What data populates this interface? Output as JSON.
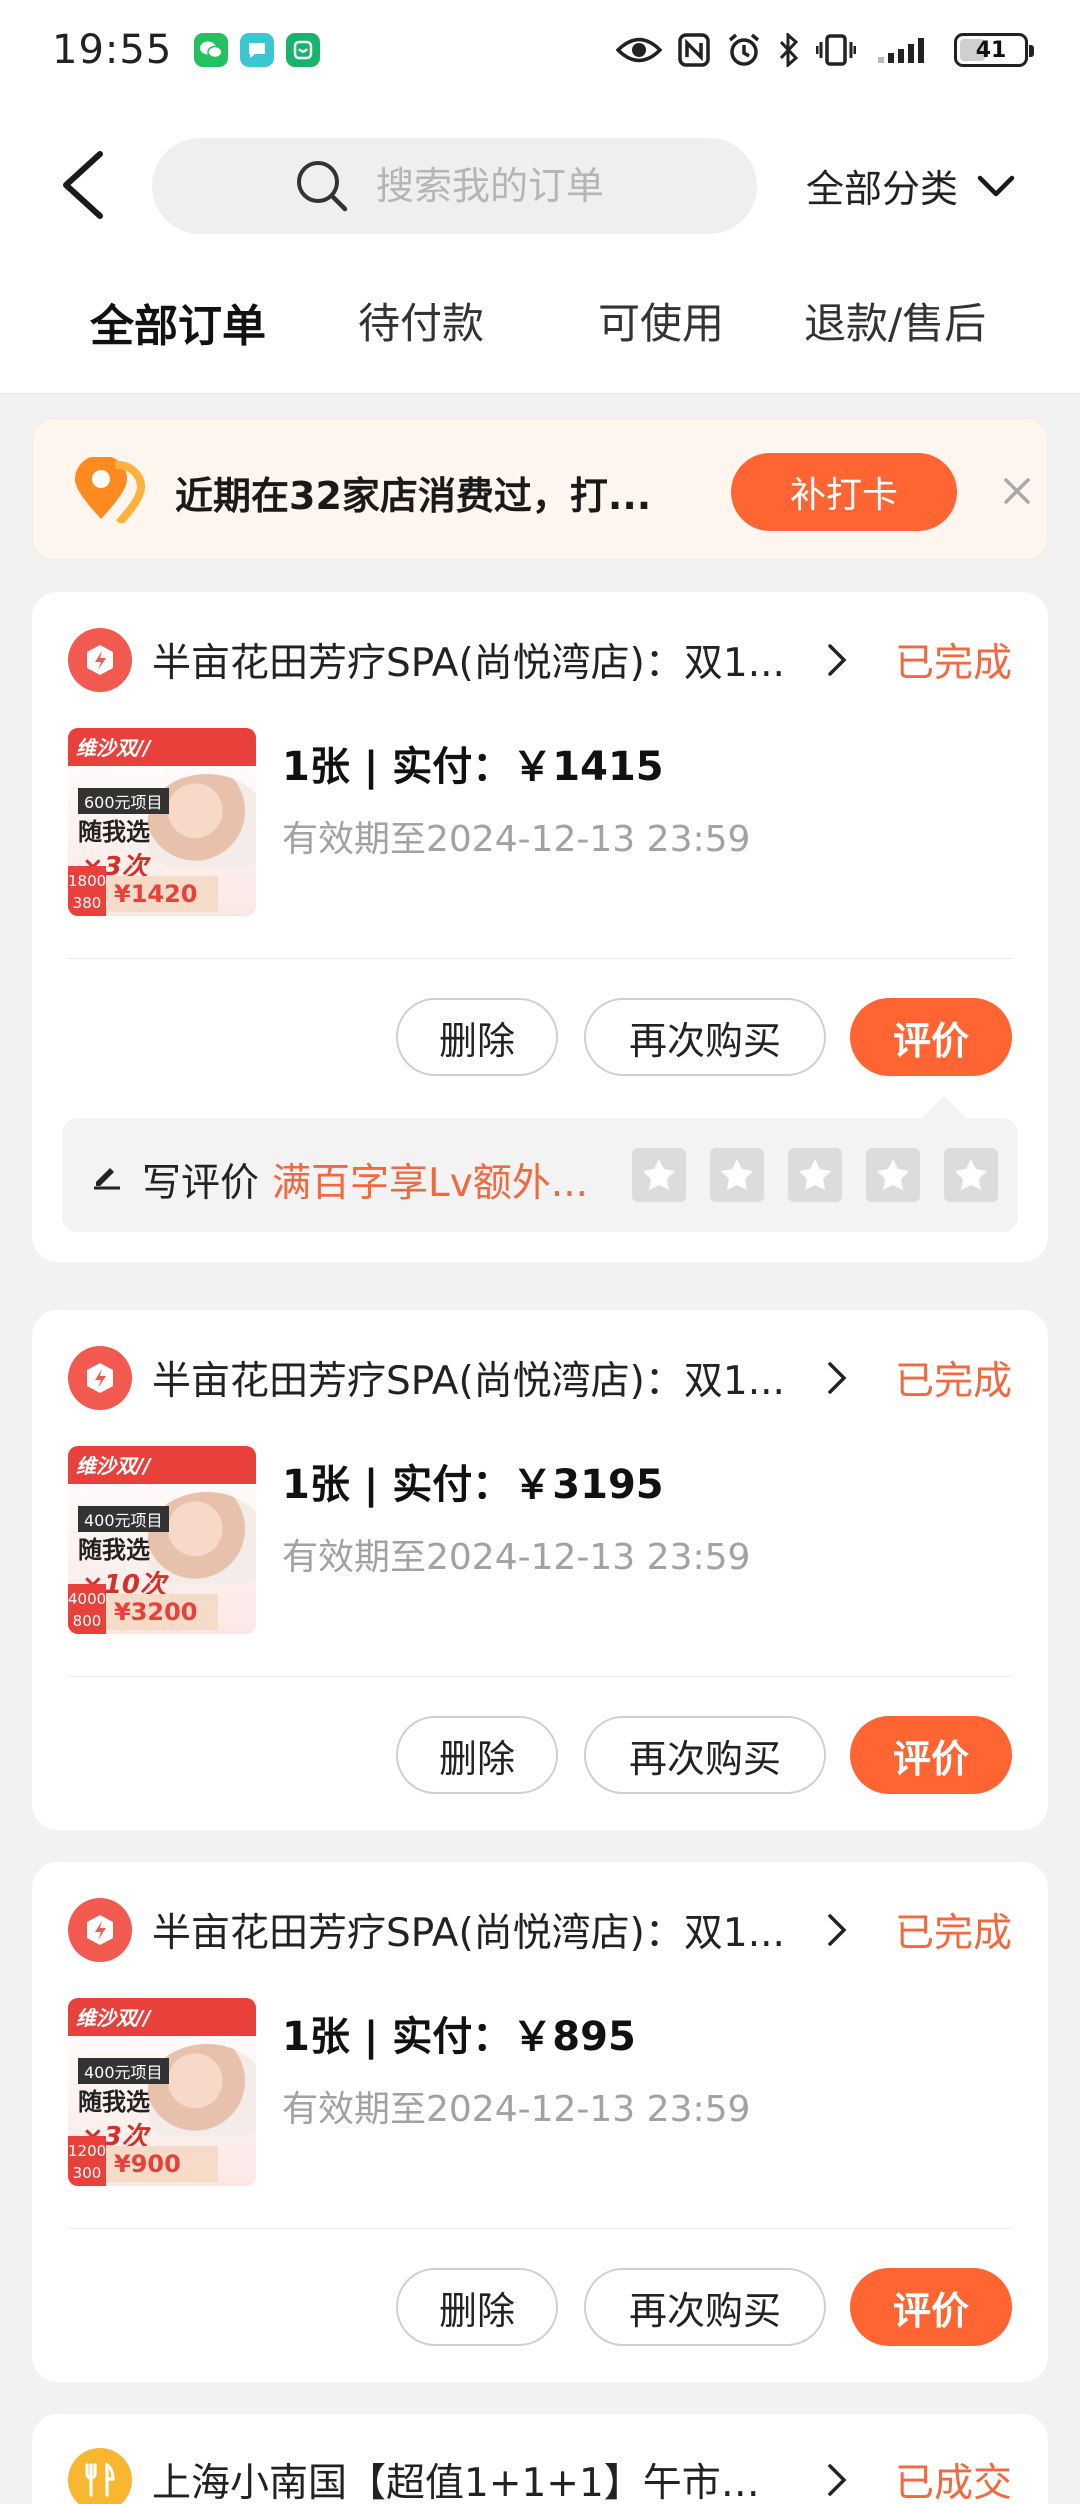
{
  "status_bar": {
    "time": "19:55",
    "battery": "41",
    "battery_level": 0.41
  },
  "header": {
    "search_placeholder": "搜索我的订单",
    "category_label": "全部分类"
  },
  "tabs": [
    {
      "label": "全部订单",
      "active": true
    },
    {
      "label": "待付款",
      "active": false
    },
    {
      "label": "可使用",
      "active": false
    },
    {
      "label": "退款/售后",
      "active": false
    }
  ],
  "banner": {
    "text": "近期在32家店消费过，打...",
    "button": "补打卡"
  },
  "orders": [
    {
      "shop": "半亩花田芳疗SPA(尚悦湾店)：双1...",
      "status": "已完成",
      "qty_price": "1张 | 实付：￥1415",
      "valid": "有效期至2024-12-13 23:59",
      "thumb": {
        "brand": "维沙双//",
        "label": "600元项目",
        "select": "随我选",
        "times": "×3次",
        "orig_top": "1800",
        "orig_bottom": "380",
        "price": "¥1420"
      },
      "delete": "删除",
      "rebuy": "再次购买",
      "review_btn": "评价",
      "review": {
        "label": "写评价",
        "promo": "满百字享Lv额外..."
      }
    },
    {
      "shop": "半亩花田芳疗SPA(尚悦湾店)：双1...",
      "status": "已完成",
      "qty_price": "1张 | 实付：￥3195",
      "valid": "有效期至2024-12-13 23:59",
      "thumb": {
        "brand": "维沙双//",
        "label": "400元项目",
        "select": "随我选",
        "times": "×10次",
        "orig_top": "4000",
        "orig_bottom": "800",
        "price": "¥3200"
      },
      "delete": "删除",
      "rebuy": "再次购买",
      "review_btn": "评价"
    },
    {
      "shop": "半亩花田芳疗SPA(尚悦湾店)：双1...",
      "status": "已完成",
      "qty_price": "1张 | 实付：￥895",
      "valid": "有效期至2024-12-13 23:59",
      "thumb": {
        "brand": "维沙双//",
        "label": "400元项目",
        "select": "随我选",
        "times": "×3次",
        "orig_top": "1200",
        "orig_bottom": "300",
        "price": "¥900"
      },
      "delete": "删除",
      "rebuy": "再次购买",
      "review_btn": "评价"
    },
    {
      "shop": "上海小南国【超值1+1+1】午市单...",
      "status": "已成交"
    }
  ],
  "colors": {
    "accent": "#ff6533",
    "status": "#f0693f",
    "shop_icon": "#f25a4f",
    "food_icon": "#f7b731"
  }
}
